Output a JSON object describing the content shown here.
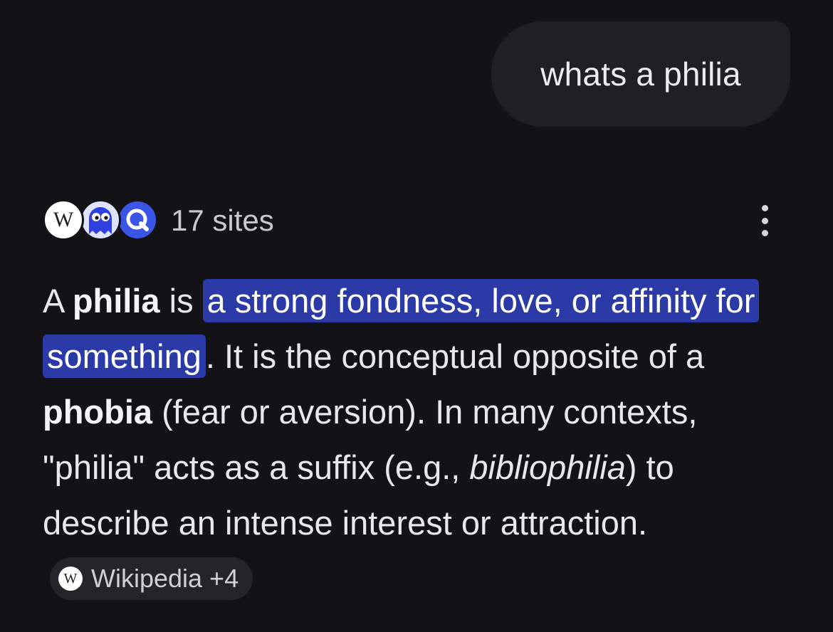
{
  "user_message": "whats a philia",
  "sources": {
    "favicons": [
      "wikipedia-icon",
      "ghost-icon",
      "search-q-icon"
    ],
    "wikipedia_letter": "W",
    "count_label": "17 sites"
  },
  "answer": {
    "p1": "A ",
    "p1_bold": "philia",
    "p2": " is ",
    "highlight": "a strong fondness, love, or affinity for something",
    "p3": ". It is the conceptual opposite of a ",
    "p3_bold": "phobia",
    "p4": " (fear or aversion). In many contexts, \"philia\" acts as a suffix (e.g., ",
    "p4_italic": "bibliophilia",
    "p5": ") to describe an intense interest or attraction."
  },
  "citation": {
    "letter": "W",
    "label": "Wikipedia +4"
  },
  "colors": {
    "background": "#121217",
    "bubble": "#1f1f25",
    "highlight": "#2b3aa6",
    "chip": "#24242b"
  }
}
